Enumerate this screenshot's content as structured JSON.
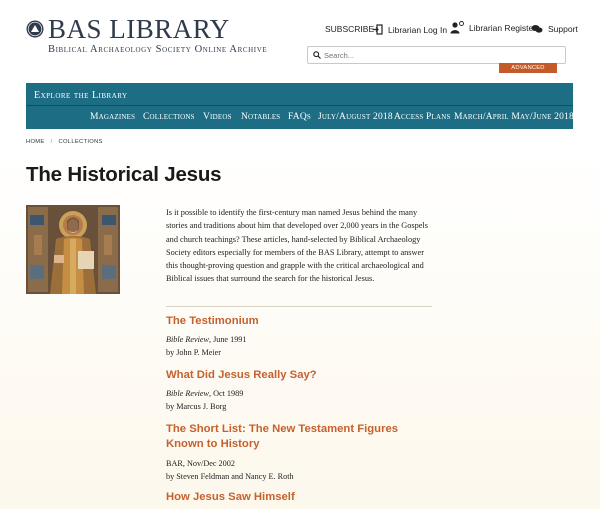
{
  "header": {
    "logo_title": "BAS LIBRARY",
    "logo_subtitle": "Biblical Archaeology Society Online Archive",
    "links": {
      "subscribe": "SUBSCRIBE",
      "login": "Librarian Log In",
      "register": "Librarian Register",
      "support": "Support"
    },
    "search_placeholder": "Search...",
    "advanced_search": "ADVANCED SEARCH"
  },
  "nav": {
    "explore": "Explore the Library",
    "items": [
      "Magazines",
      "Collections",
      "Videos",
      "Notables",
      "FAQs",
      "July/August 2018",
      "Access Plans",
      "March/April May/June 2018"
    ]
  },
  "breadcrumb": {
    "home": "HOME",
    "sep": "/",
    "current": "COLLECTIONS"
  },
  "page_title": "The Historical Jesus",
  "intro": "Is it possible to identify the first-century man named Jesus behind the many stories and traditions about him that developed over 2,000 years in the Gospels and church teachings? These articles, hand-selected by Biblical Archaeology Society editors especially for members of the BAS Library, attempt to answer this thought-proving question and grapple with the critical archaeological and Biblical issues that surround the search for the historical Jesus.",
  "articles": [
    {
      "title": "The Testimonium",
      "publication": "Bible Review",
      "date": ", June 1991",
      "author": "by John P. Meier"
    },
    {
      "title": "What Did Jesus Really Say?",
      "publication": "Bible Review",
      "date": ", Oct 1989",
      "author": "by Marcus J. Borg"
    },
    {
      "title": "The Short List: The New Testament Figures Known to History",
      "publication": "BAR",
      "date": ", Nov/Dec 2002",
      "author": "by Steven Feldman and Nancy E. Roth"
    },
    {
      "title": "How Jesus Saw Himself"
    }
  ],
  "colors": {
    "nav": "#1d6e85",
    "accent": "#c4612e",
    "advanced": "#c55a2b"
  }
}
